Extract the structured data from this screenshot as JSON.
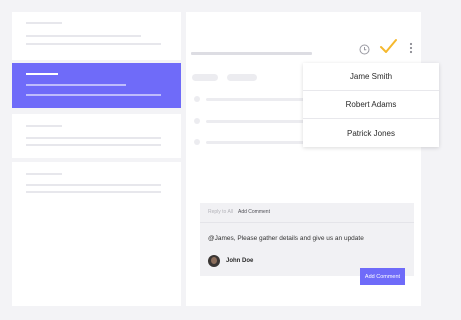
{
  "assignee_dropdown": {
    "options": [
      "Jame Smith",
      "Robert Adams",
      "Patrick Jones"
    ]
  },
  "comment_box": {
    "tabs": {
      "reply_to_all": "Reply to All",
      "add_comment": "Add Comment"
    },
    "text": "@James, Please gather details and give us an update",
    "author": "John Doe",
    "submit_label": "Add Comment"
  },
  "icons": {
    "history": "clock-icon",
    "done": "checkmark-icon",
    "menu": "more-vertical-icon"
  },
  "colors": {
    "accent": "#6f6bf9",
    "check": "#f5b82e",
    "background": "#f3f3f6"
  }
}
